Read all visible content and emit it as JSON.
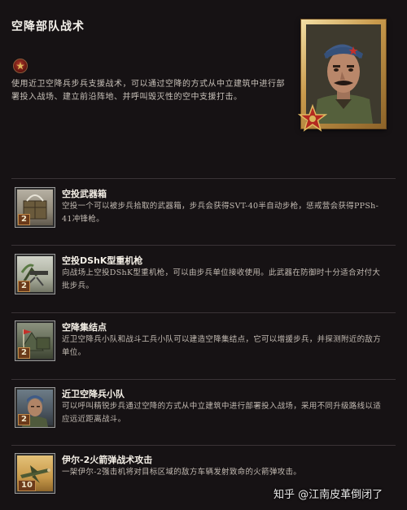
{
  "page": {
    "title": "空降部队战术",
    "description": "使用近卫空降兵步兵支援战术，可以通过空降的方式从中立建筑中进行部署投入战场、建立前沿阵地、并呼叫毁灭性的空中支援打击。"
  },
  "portrait": {
    "icon": "commander-portrait"
  },
  "abilities": [
    {
      "name": "空投武器箱",
      "desc": "空投一个可以被步兵拾取的武器箱，步兵会获得SVT-40半自动步枪，惩戒营会获得PPSh-41冲锋枪。",
      "cost": "2",
      "icon": "weapon-crate-icon"
    },
    {
      "name": "空投DShK型重机枪",
      "desc": "向战场上空投DShK型重机枪，可以由步兵单位接收使用。此武器在防御时十分适合对付大批步兵。",
      "cost": "2",
      "icon": "heavy-machine-gun-icon"
    },
    {
      "name": "空降集结点",
      "desc": "近卫空降兵小队和战斗工兵小队可以建造空降集结点，它可以增援步兵，并探测附近的敌方单位。",
      "cost": "2",
      "icon": "rally-point-icon"
    },
    {
      "name": "近卫空降兵小队",
      "desc": "可以呼叫精锐步兵通过空降的方式从中立建筑中进行部署投入战场，采用不同升级路线以适应远近距离战斗。",
      "cost": "2",
      "icon": "paratrooper-squad-icon"
    },
    {
      "name": "伊尔-2火箭弹战术攻击",
      "desc": "一架伊尔-2强击机将对目标区域的敌方车辆发射致命的火箭弹攻击。",
      "cost": "10",
      "icon": "il2-rocket-strike-icon"
    }
  ],
  "watermark": "知乎 @江南皮革倒闭了"
}
